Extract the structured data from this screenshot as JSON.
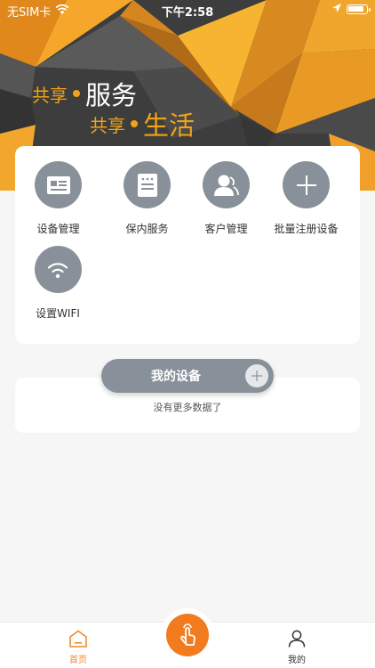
{
  "status_bar": {
    "carrier": "无SIM卡",
    "time": "下午2:58"
  },
  "hero": {
    "line1_small": "共享",
    "line1_big": "服务",
    "line2_small": "共享",
    "line2_big": "生活"
  },
  "grid": {
    "items": [
      {
        "label": "设备管理",
        "icon": "id-card-icon"
      },
      {
        "label": "保内服务",
        "icon": "document-icon"
      },
      {
        "label": "客户管理",
        "icon": "customer-icon"
      },
      {
        "label": "批量注册设备",
        "icon": "plus-icon"
      },
      {
        "label": "设置WIFI",
        "icon": "wifi-icon"
      }
    ]
  },
  "devices": {
    "title": "我的设备",
    "empty_text": "没有更多数据了"
  },
  "tab_bar": {
    "home_label": "首页",
    "mine_label": "我的"
  },
  "colors": {
    "accent": "#f27b1f",
    "slogan": "#f2a316",
    "icon_bg": "#889199",
    "page_bg": "#f6f6f6"
  }
}
